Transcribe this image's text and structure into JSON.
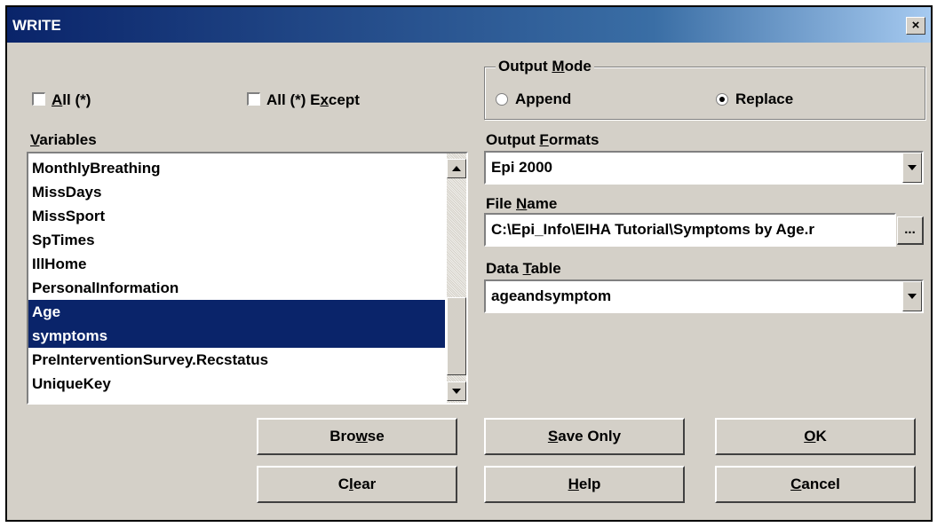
{
  "window": {
    "title": "WRITE",
    "close_glyph": "×"
  },
  "checks": {
    "all": {
      "pre": "",
      "ul": "A",
      "post": "ll (*)",
      "checked": false
    },
    "all_except": {
      "pre": "All (*) E",
      "ul": "x",
      "post": "cept",
      "checked": false
    }
  },
  "variables": {
    "label_ul": "V",
    "label_post": "ariables",
    "items": [
      {
        "text": "MonthlyBreathing",
        "selected": false
      },
      {
        "text": "MissDays",
        "selected": false
      },
      {
        "text": "MissSport",
        "selected": false
      },
      {
        "text": "SpTimes",
        "selected": false
      },
      {
        "text": "IllHome",
        "selected": false
      },
      {
        "text": "PersonalInformation",
        "selected": false
      },
      {
        "text": "Age",
        "selected": true
      },
      {
        "text": "symptoms",
        "selected": true
      },
      {
        "text": "PreInterventionSurvey.Recstatus",
        "selected": false
      },
      {
        "text": "UniqueKey",
        "selected": false
      }
    ]
  },
  "output_mode": {
    "legend_pre": "Output ",
    "legend_ul": "M",
    "legend_post": "ode",
    "append": {
      "label": "Append",
      "selected": false
    },
    "replace": {
      "label": "Replace",
      "selected": true
    }
  },
  "output_formats": {
    "label_pre": "Output ",
    "label_ul": "F",
    "label_post": "ormats",
    "value": "Epi 2000"
  },
  "file_name": {
    "label_pre": "File ",
    "label_ul": "N",
    "label_post": "ame",
    "value": "C:\\Epi_Info\\EIHA Tutorial\\Symptoms by Age.r",
    "browse_label": "..."
  },
  "data_table": {
    "label_pre": "Data ",
    "label_ul": "T",
    "label_post": "able",
    "value": "ageandsymptom"
  },
  "buttons": {
    "browse": {
      "pre": "Bro",
      "ul": "w",
      "post": "se"
    },
    "save_only": {
      "pre": "",
      "ul": "S",
      "post": "ave Only"
    },
    "ok": {
      "pre": "",
      "ul": "O",
      "post": "K"
    },
    "clear": {
      "pre": "C",
      "ul": "l",
      "post": "ear"
    },
    "help": {
      "pre": "",
      "ul": "H",
      "post": "elp"
    },
    "cancel": {
      "pre": "",
      "ul": "C",
      "post": "ancel"
    }
  }
}
